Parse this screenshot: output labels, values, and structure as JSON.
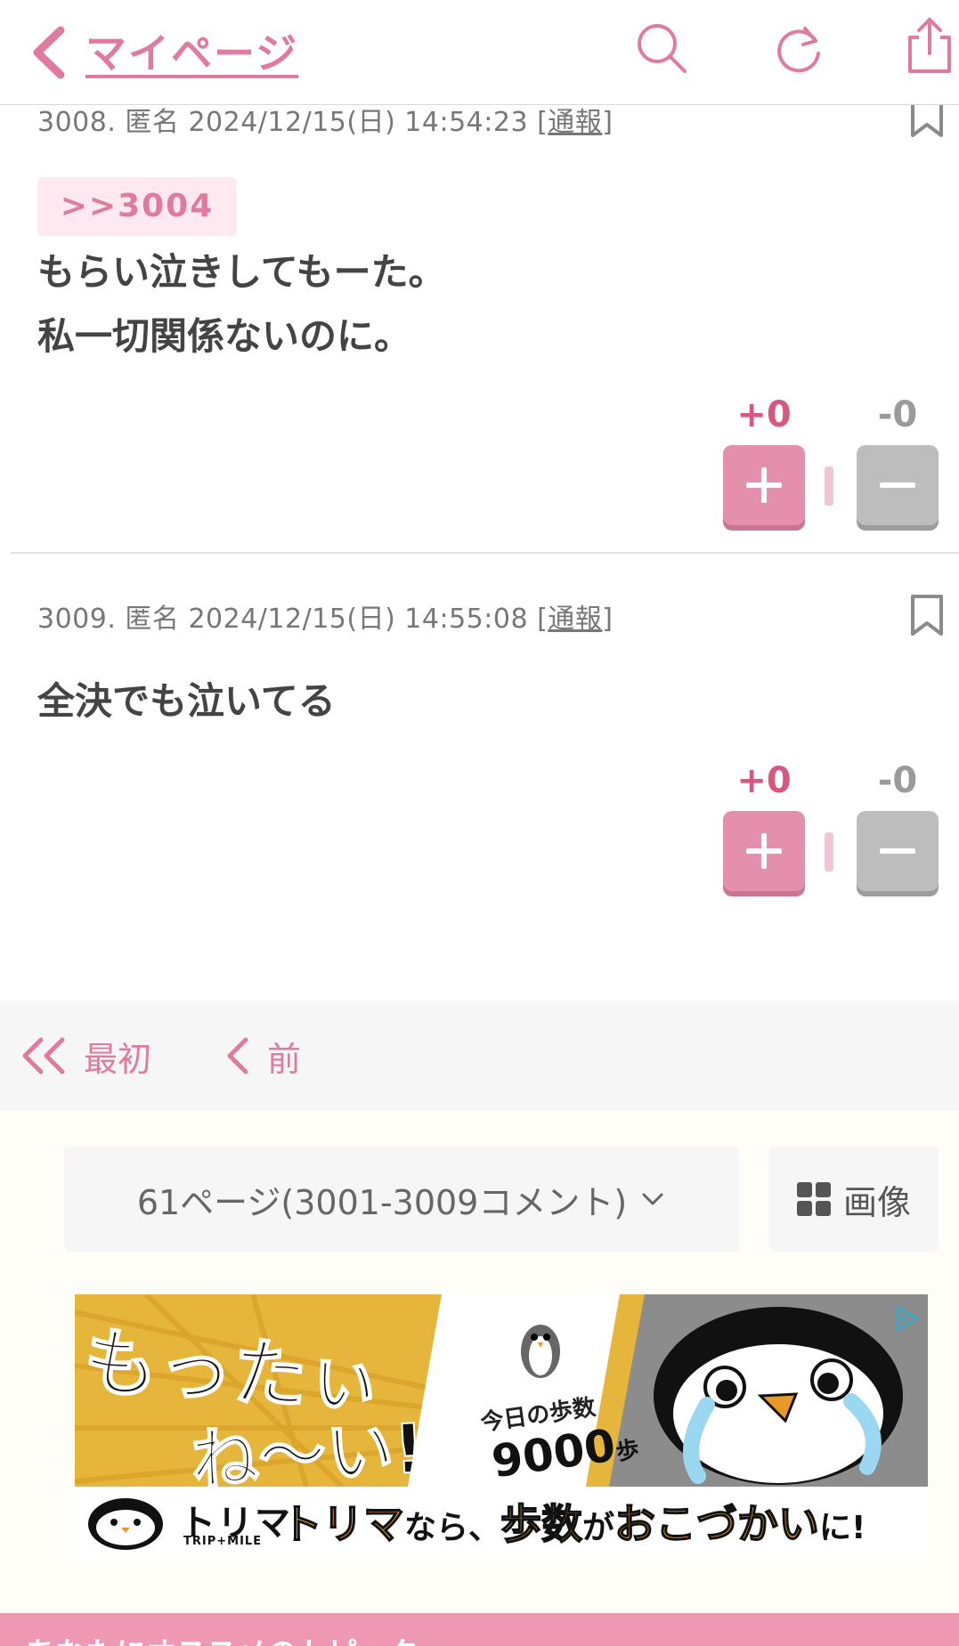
{
  "header": {
    "title": "マイページ",
    "icons": [
      "back-chevron-icon",
      "search-icon",
      "refresh-icon",
      "share-icon"
    ]
  },
  "comments": [
    {
      "meta_prefix": "3008. 匿名 2024/12/15(日) 14:54:23 [",
      "report_label": "通報",
      "meta_suffix": "]",
      "anchor": ">>3004",
      "lines": [
        "もらい泣きしてもーた。",
        "私一切関係ないのに。"
      ],
      "plus_count": "+0",
      "minus_count": "-0"
    },
    {
      "meta_prefix": "3009. 匿名 2024/12/15(日) 14:55:08 [",
      "report_label": "通報",
      "meta_suffix": "]",
      "lines": [
        "全決でも泣いてる"
      ],
      "plus_count": "+0",
      "minus_count": "-0"
    }
  ],
  "pager": {
    "first_label": "最初",
    "prev_label": "前"
  },
  "page_select": {
    "value": "61ページ(3001-3009コメント)",
    "image_label": "画像"
  },
  "ad": {
    "headline_1": "もったぃ",
    "headline_2": "ね〜い!",
    "steps_label": "今日の歩数",
    "steps_value": "9000",
    "steps_unit": "歩",
    "brand": "トリマ",
    "brand_sub": "TRIP+MILE",
    "tagline_1": "トリマ",
    "tagline_2": "なら、",
    "tagline_3": "歩数",
    "tagline_4": "が",
    "tagline_5": "おこづかい",
    "tagline_6": "に!"
  },
  "recommend": {
    "label": "あなたにオススメのトピック"
  },
  "colors": {
    "accent": "#e07a9e",
    "plus_button": "#e48fab",
    "minus_button": "#bdbdbd"
  }
}
